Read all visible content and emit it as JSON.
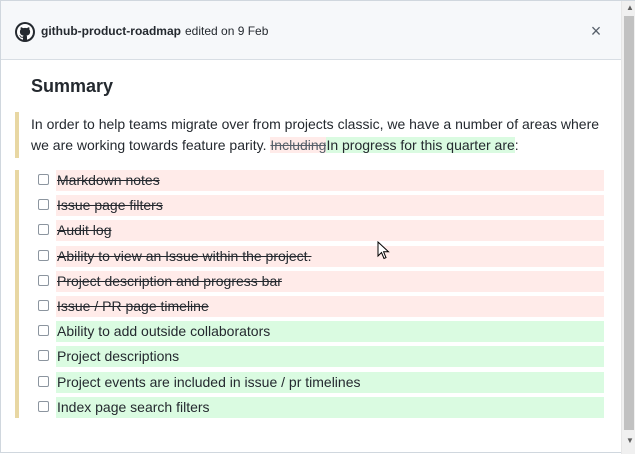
{
  "header": {
    "avatar_icon": "github-mark-icon",
    "user": "github-product-roadmap",
    "meta": "edited on 9 Feb",
    "close_label": "×"
  },
  "summary": {
    "title": "Summary",
    "para_text": "In order to help teams migrate over from projects classic, we have a number of areas where we are working towards feature parity.",
    "para_deleted": "Including",
    "para_inserted": "In progress for this quarter are",
    "para_tail": ":"
  },
  "tasks": [
    {
      "label": "Markdown notes",
      "status": "removed",
      "checked": false
    },
    {
      "label": "Issue page filters",
      "status": "removed",
      "checked": false
    },
    {
      "label": "Audit log",
      "status": "removed",
      "checked": false
    },
    {
      "label": "Ability to view an Issue within the project.",
      "status": "removed",
      "checked": false
    },
    {
      "label": "Project description and progress bar",
      "status": "removed",
      "checked": false
    },
    {
      "label": "Issue / PR page timeline",
      "status": "removed",
      "checked": false
    },
    {
      "label": "Ability to add outside collaborators",
      "status": "added",
      "checked": false
    },
    {
      "label": "Project descriptions",
      "status": "added",
      "checked": false
    },
    {
      "label": "Project events are included in issue / pr timelines",
      "status": "added",
      "checked": false
    },
    {
      "label": "Index page search filters",
      "status": "added",
      "checked": false
    }
  ],
  "colors": {
    "removed_bg": "#ffebe9",
    "added_bg": "#dafbe1",
    "quote_bar": "#e8d7a3"
  },
  "scrollbar": {
    "up_icon": "scroll-up-arrow-icon",
    "down_icon": "scroll-down-arrow-icon"
  }
}
